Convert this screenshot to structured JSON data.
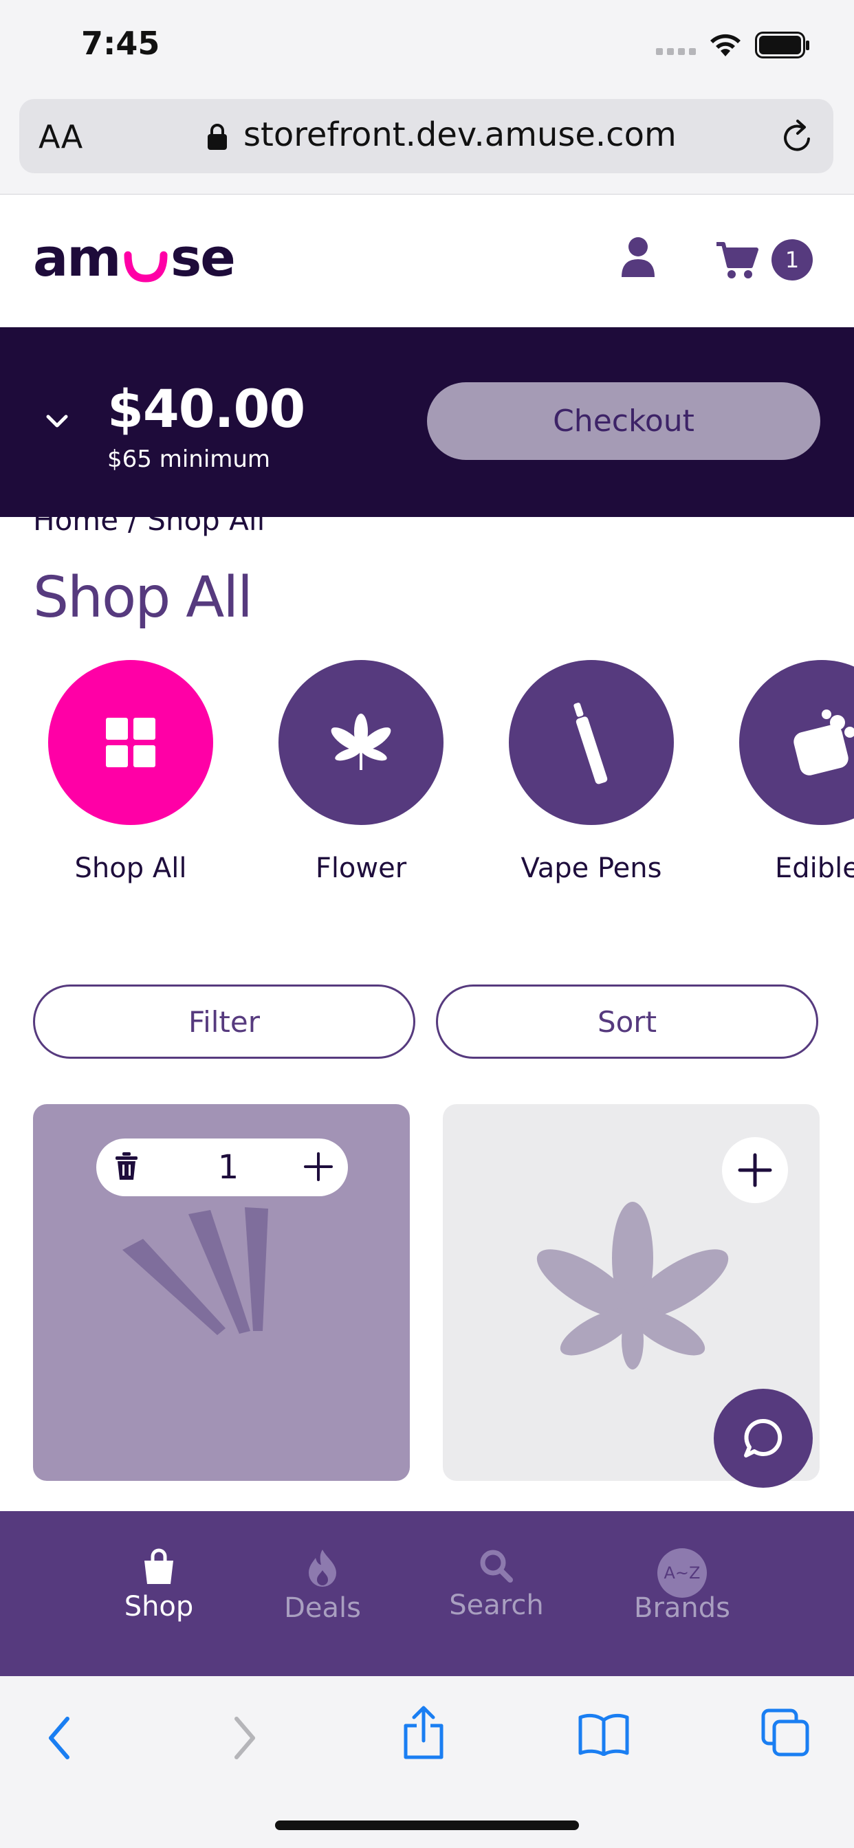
{
  "status_bar": {
    "time": "7:45"
  },
  "browser": {
    "text_size_label": "AA",
    "url": "storefront.dev.amuse.com"
  },
  "header": {
    "logo": "amuse",
    "cart_count": "1"
  },
  "cart_bar": {
    "total": "$40.00",
    "minimum": "$65 minimum",
    "checkout_label": "Checkout"
  },
  "breadcrumb": {
    "home": "Home",
    "separator": "/",
    "current": "Shop All"
  },
  "page_title": "Shop All",
  "categories": [
    {
      "label": "Shop All",
      "icon": "grid-icon",
      "active": true
    },
    {
      "label": "Flower",
      "icon": "leaf-icon"
    },
    {
      "label": "Vape Pens",
      "icon": "vape-pen-icon"
    },
    {
      "label": "Edibles",
      "icon": "edible-icon"
    }
  ],
  "controls": {
    "filter_label": "Filter",
    "sort_label": "Sort"
  },
  "products": [
    {
      "quantity": "1",
      "image": "pre-roll-icon",
      "bg_color": "#a293b5"
    },
    {
      "image": "leaf-icon",
      "bg_color": "#ebebed"
    }
  ],
  "bottom_nav": [
    {
      "label": "Shop",
      "icon": "shopping-bag-icon",
      "active": true
    },
    {
      "label": "Deals",
      "icon": "flame-icon"
    },
    {
      "label": "Search",
      "icon": "search-icon"
    },
    {
      "label": "Brands",
      "icon": "a-z-icon",
      "badge": "A~Z"
    }
  ],
  "colors": {
    "brand_purple": "#563a7e",
    "dark_purple": "#1e0b3a",
    "pink": "#ff00a6",
    "ios_blue": "#1a7ef2"
  }
}
